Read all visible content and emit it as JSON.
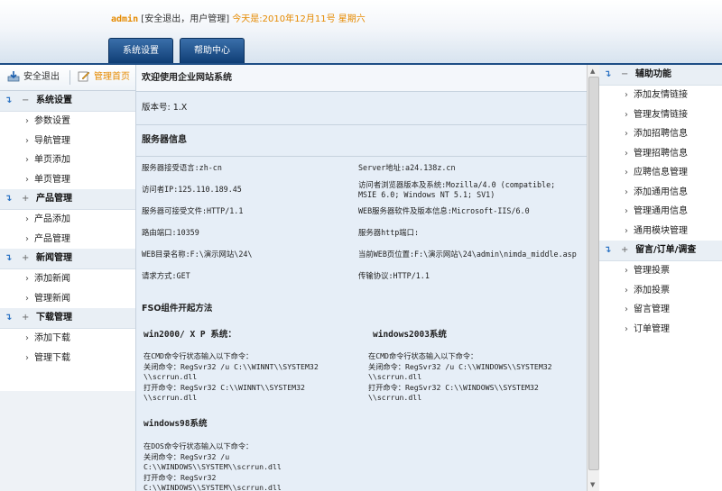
{
  "top": {
    "user": "admin",
    "links": "[安全退出，用户管理]",
    "date": "今天是:2010年12月11号 星期六"
  },
  "tabs": [
    {
      "label": "系统设置"
    },
    {
      "label": "帮助中心"
    }
  ],
  "leftbar": {
    "logout": "安全退出",
    "home": "管理首页"
  },
  "left_sections": [
    {
      "title": "系统设置",
      "toggle": "−",
      "items": [
        "参数设置",
        "导航管理",
        "单页添加",
        "单页管理"
      ]
    },
    {
      "title": "产品管理",
      "toggle": "+",
      "items": [
        "产品添加",
        "产品管理"
      ]
    },
    {
      "title": "新闻管理",
      "toggle": "+",
      "items": [
        "添加新闻",
        "管理新闻"
      ]
    },
    {
      "title": "下载管理",
      "toggle": "+",
      "items": [
        "添加下载",
        "管理下载"
      ]
    }
  ],
  "main": {
    "welcome": "欢迎使用企业网站系统",
    "version": "版本号: 1.X",
    "server_header": "服务器信息",
    "rows": [
      [
        "服务器接受语言:zh-cn",
        "Server地址:a24.138z.cn"
      ],
      [
        "访问者IP:125.110.189.45",
        "访问者浏览器版本及系统:Mozilla/4.0 (compatible;\nMSIE 6.0; Windows NT 5.1; SV1)"
      ],
      [
        "服务器可接受文件:HTTP/1.1",
        "WEB服务器软件及版本信息:Microsoft-IIS/6.0"
      ],
      [
        "路由端口:10359",
        "服务器http端口:"
      ],
      [
        "WEB目录名称:F:\\演示网站\\24\\",
        "当前WEB页位置:F:\\演示网站\\24\\admin\\nimda_middle.asp"
      ],
      [
        "请求方式:GET",
        "传输协议:HTTP/1.1"
      ]
    ],
    "fso_header": "FSO组件开起方法",
    "fso": {
      "win2000_title": "win2000/ X P 系统：",
      "win2000_text": "在CMD命令行状态输入以下命令：\n关闭命令：RegSvr32 /u C:\\\\WINNT\\\\SYSTEM32\n\\\\scrrun.dll\n打开命令：RegSvr32 C:\\\\WINNT\\\\SYSTEM32\n\\\\scrrun.dll",
      "win2003_title": "windows2003系统",
      "win2003_text": "在CMD命令行状态输入以下命令：\n关闭命令：RegSvr32 /u C:\\\\WINDOWS\\\\SYSTEM32\n\\\\scrrun.dll\n打开命令：RegSvr32 C:\\\\WINDOWS\\\\SYSTEM32\n\\\\scrrun.dll",
      "win98_title": "windows98系统",
      "win98_text": "在DOS命令行状态输入以下命令：\n关闭命令：RegSvr32 /u\nC:\\\\WINDOWS\\\\SYSTEM\\\\scrrun.dll\n打开命令：RegSvr32\nC:\\\\WINDOWS\\\\SYSTEM\\\\scrrun.dll"
    }
  },
  "right_sections": [
    {
      "title": "辅助功能",
      "toggle": "−",
      "items": [
        "添加友情链接",
        "管理友情链接",
        "添加招聘信息",
        "管理招聘信息",
        "应聘信息管理",
        "添加通用信息",
        "管理通用信息",
        "通用模块管理"
      ]
    },
    {
      "title": "留言/订单/调查",
      "toggle": "+",
      "items": [
        "管理投票",
        "添加投票",
        "留言管理",
        "订单管理"
      ]
    }
  ],
  "colors": {
    "accent": "#e58a00",
    "nav": "#1e4e86",
    "panel": "#e6eef7"
  }
}
